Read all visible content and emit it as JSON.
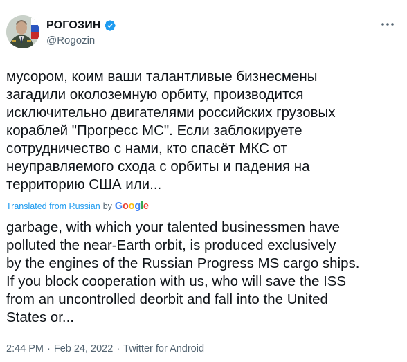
{
  "author": {
    "display_name": "РОГОЗИН",
    "handle": "@Rogozin",
    "verified_icon": "verified-badge-icon",
    "avatar_icon": "avatar-portrait",
    "more_icon": "more-options-icon"
  },
  "tweet": {
    "text_ru": "мусором, коим ваши талантливые бизнесмены\nзагадили околоземную орбиту, производится\nисключительно двигателями российских грузовых\nкораблей \"Прогресс МС\". Если заблокируете\nсотрудничество с нами, кто спасёт МКС от\nнеуправляемого схода с орбиты и падения на\nтерриторию США или...",
    "translation_label": "Translated from Russian",
    "translation_by": "by",
    "google": {
      "G": "G",
      "o1": "o",
      "o2": "o",
      "g": "g",
      "l": "l",
      "e": "e"
    },
    "text_en": "garbage, with which your talented businessmen have\npolluted the near-Earth orbit, is produced exclusively\nby the engines of the Russian Progress MS cargo ships.\nIf you block cooperation with us, who will save the ISS\nfrom an uncontrolled deorbit and fall into the United\nStates or..."
  },
  "meta": {
    "time": "2:44 PM",
    "separator": "·",
    "date": "Feb 24, 2022",
    "source": "Twitter for Android"
  },
  "colors": {
    "link": "#1d9bf0",
    "secondary": "#536471",
    "text": "#0f1419"
  }
}
